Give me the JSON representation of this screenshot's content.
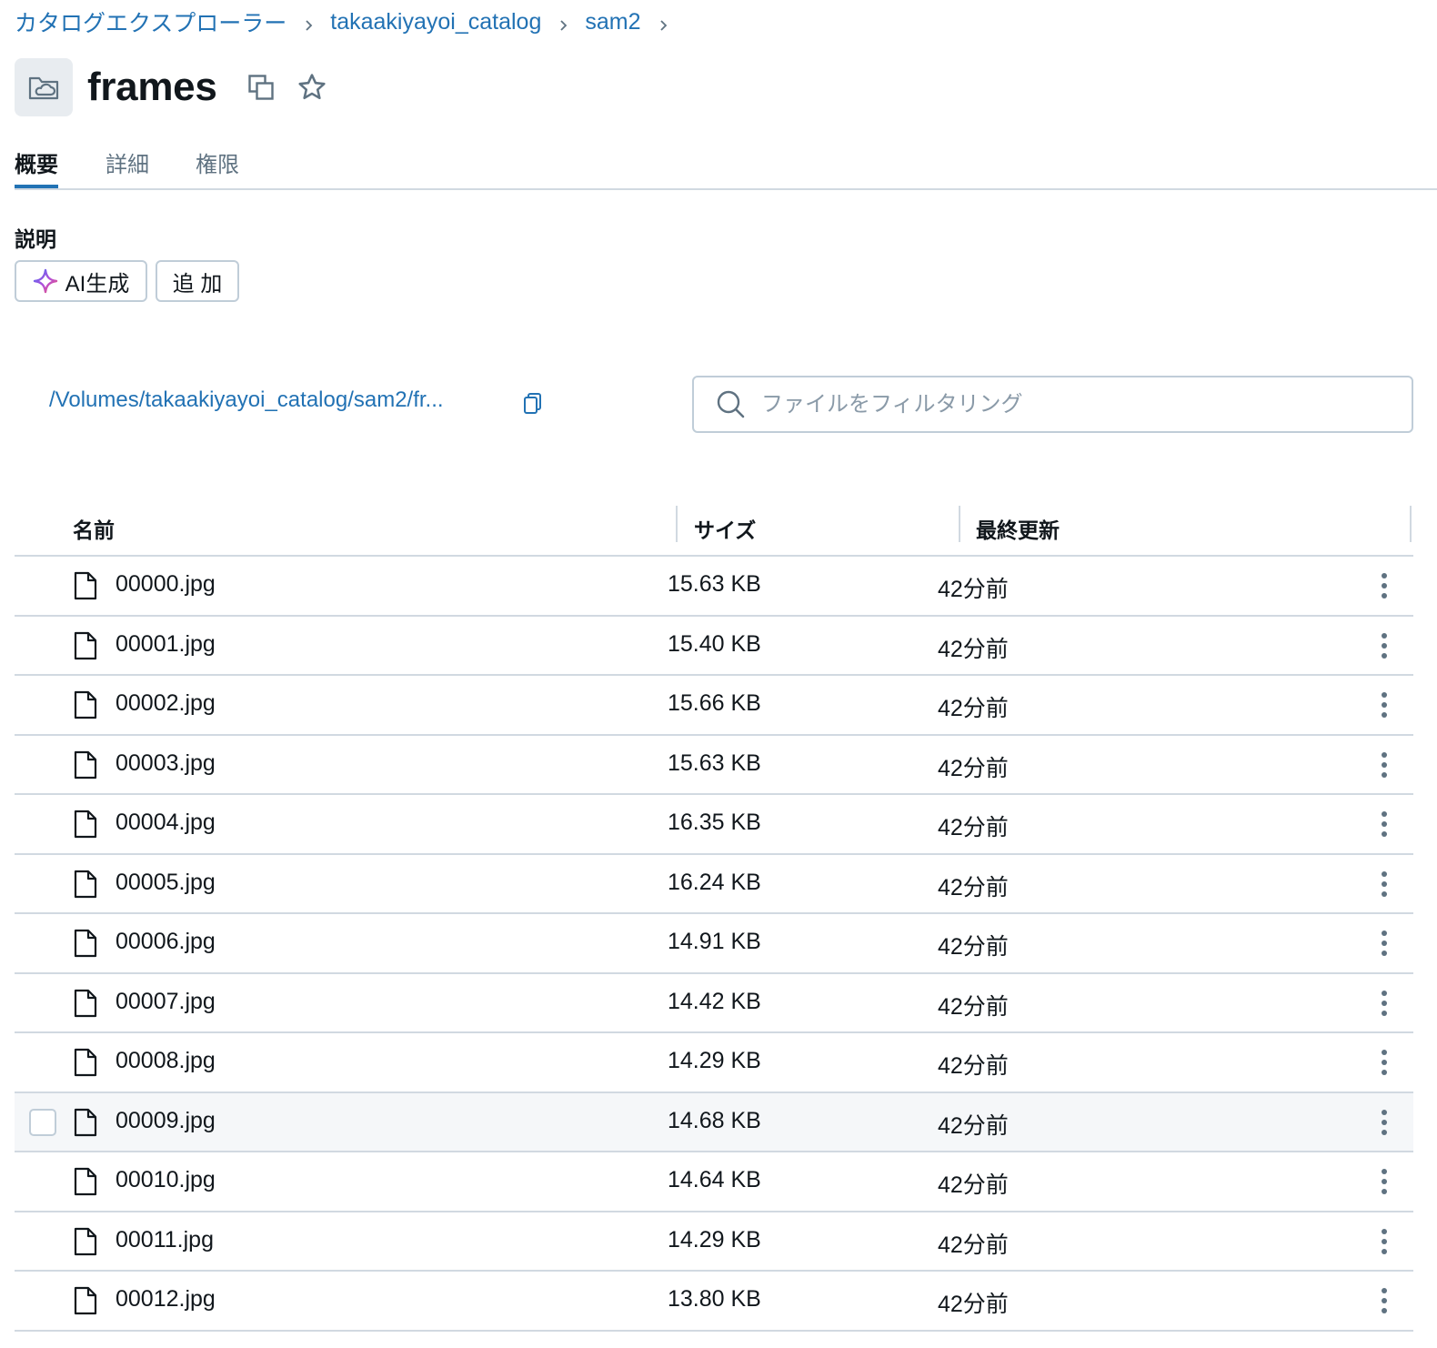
{
  "breadcrumb": {
    "items": [
      "カタログエクスプローラー",
      "takaakiyayoi_catalog",
      "sam2"
    ]
  },
  "header": {
    "title": "frames",
    "icon": "volume-folder-icon"
  },
  "tabs": [
    "概要",
    "詳細",
    "権限"
  ],
  "active_tab": "概要",
  "description": {
    "label": "説明",
    "ai_button": "AI生成",
    "add_button": "追 加"
  },
  "path": {
    "text": "/Volumes/takaakiyayoi_catalog/sam2/fr..."
  },
  "filter": {
    "placeholder": "ファイルをフィルタリング"
  },
  "table": {
    "columns": [
      "名前",
      "サイズ",
      "最終更新"
    ],
    "rows": [
      {
        "name": "00000.jpg",
        "size": "15.63 KB",
        "modified": "42分前"
      },
      {
        "name": "00001.jpg",
        "size": "15.40 KB",
        "modified": "42分前"
      },
      {
        "name": "00002.jpg",
        "size": "15.66 KB",
        "modified": "42分前"
      },
      {
        "name": "00003.jpg",
        "size": "15.63 KB",
        "modified": "42分前"
      },
      {
        "name": "00004.jpg",
        "size": "16.35 KB",
        "modified": "42分前"
      },
      {
        "name": "00005.jpg",
        "size": "16.24 KB",
        "modified": "42分前"
      },
      {
        "name": "00006.jpg",
        "size": "14.91 KB",
        "modified": "42分前"
      },
      {
        "name": "00007.jpg",
        "size": "14.42 KB",
        "modified": "42分前"
      },
      {
        "name": "00008.jpg",
        "size": "14.29 KB",
        "modified": "42分前"
      },
      {
        "name": "00009.jpg",
        "size": "14.68 KB",
        "modified": "42分前",
        "hovered": true
      },
      {
        "name": "00010.jpg",
        "size": "14.64 KB",
        "modified": "42分前"
      },
      {
        "name": "00011.jpg",
        "size": "14.29 KB",
        "modified": "42分前"
      },
      {
        "name": "00012.jpg",
        "size": "13.80 KB",
        "modified": "42分前"
      }
    ]
  },
  "colors": {
    "link": "#2272b4",
    "text": "#11171c",
    "muted": "#5f7281",
    "border": "#d1d9e1",
    "hover_row": "#f5f7f9"
  }
}
